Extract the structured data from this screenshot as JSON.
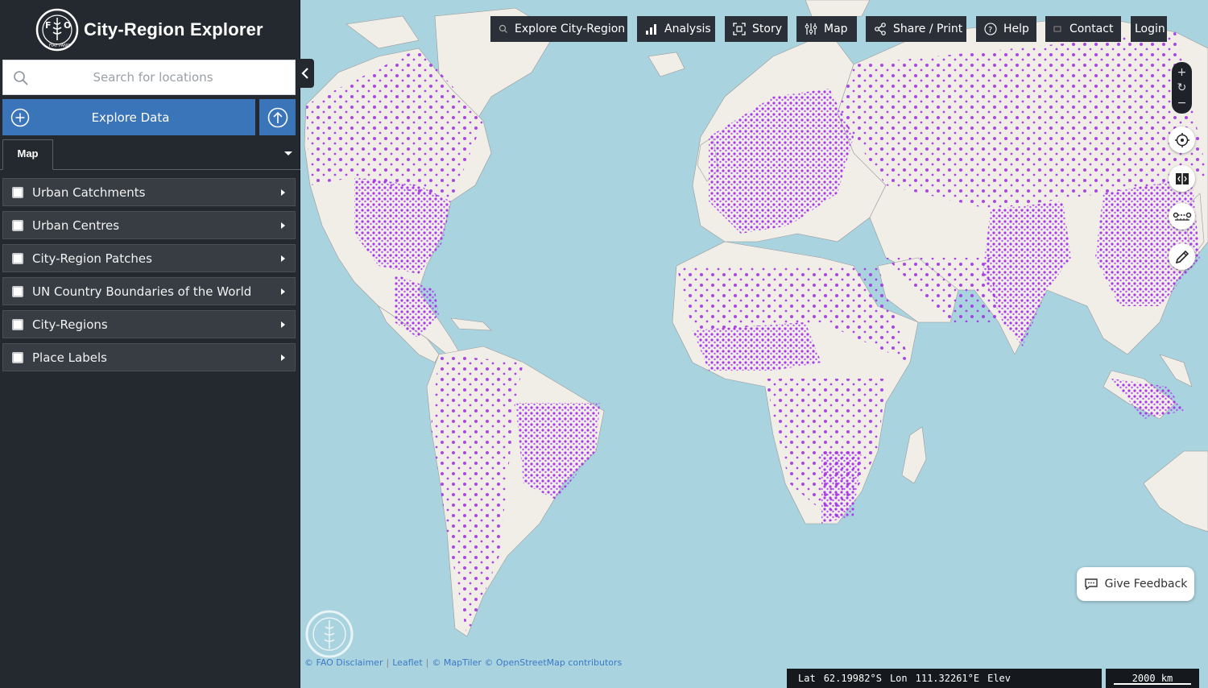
{
  "app": {
    "title": "City-Region Explorer"
  },
  "search": {
    "placeholder": "Search for locations"
  },
  "explore": {
    "label": "Explore Data"
  },
  "tabs": {
    "map_label": "Map"
  },
  "layers": [
    {
      "label": "Urban Catchments"
    },
    {
      "label": "Urban Centres"
    },
    {
      "label": "City-Region Patches"
    },
    {
      "label": "UN Country Boundaries of the World"
    },
    {
      "label": "City-Regions"
    },
    {
      "label": "Place Labels"
    }
  ],
  "nav": {
    "explore_city_region": "Explore City-Region",
    "analysis": "Analysis",
    "story": "Story",
    "map": "Map",
    "share_print": "Share / Print",
    "help": "Help",
    "contact": "Contact",
    "login": "Login"
  },
  "feedback": {
    "label": "Give Feedback"
  },
  "attribution": {
    "fao": "© FAO Disclaimer",
    "leaflet": "Leaflet",
    "maptiler": "© MapTiler © OpenStreetMap contributors"
  },
  "status": {
    "lat_label": "Lat",
    "lat": "62.19982°S",
    "lon_label": "Lon",
    "lon": "111.32261°E",
    "elev_label": "Elev",
    "scale": "2000 km"
  },
  "colors": {
    "sidebar_bg": "#24292f",
    "accent_blue": "#3a74b9",
    "ocean": "#a9d3df",
    "land": "#f1eee8",
    "urban_overlay": "#a431e8"
  }
}
